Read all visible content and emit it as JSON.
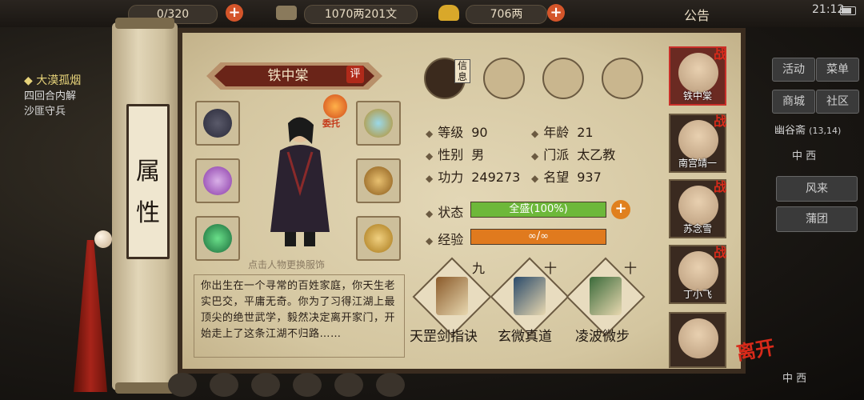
{
  "topbar": {
    "res1": "0/320",
    "coins": "1070两201文",
    "gold": "706两",
    "notice": "公告",
    "time": "21:12"
  },
  "quest": {
    "title": "大漠孤烟",
    "line1": "四回合内解",
    "line2": "沙匪守兵"
  },
  "right_menu": {
    "activity": "活动",
    "menu": "菜单",
    "shop": "商城",
    "community": "社区",
    "location": "幽谷斋",
    "coords": "(13,14)",
    "area": "中 西",
    "item1": "风来",
    "item2": "蒲团",
    "bottom": "中 西"
  },
  "scroll_tag": {
    "char1": "属",
    "char2": "性"
  },
  "character": {
    "name": "铁中棠",
    "rate_label": "评",
    "delegate_label": "委托",
    "hint": "点击人物更换服饰",
    "description": "你出生在一个寻常的百姓家庭，你天生老实巴交，平庸无奇。你为了习得江湖上最顶尖的绝世武学，毅然决定离开家门，开始走上了这条江湖不归路……"
  },
  "tabs": {
    "info_label": "信息"
  },
  "stats": {
    "level_label": "等级",
    "level": "90",
    "age_label": "年龄",
    "age": "21",
    "gender_label": "性别",
    "gender": "男",
    "sect_label": "门派",
    "sect": "太乙教",
    "power_label": "功力",
    "power": "249273",
    "fame_label": "名望",
    "fame": "937",
    "status_label": "状态",
    "status_text": "全盛(100%)",
    "status_fill": 1.0,
    "exp_label": "经验",
    "exp_text": "∞/∞",
    "exp_fill": 1.0
  },
  "skills": [
    {
      "level": "九",
      "name": "天罡剑指诀",
      "color": "#8a5a2a"
    },
    {
      "level": "十",
      "name": "玄微真道",
      "color": "#2a4a6a"
    },
    {
      "level": "十",
      "name": "凌波微步",
      "color": "#3a6a3a"
    }
  ],
  "roster": [
    {
      "name": "铁中棠",
      "tag": "战"
    },
    {
      "name": "南宫靖一",
      "tag": "战"
    },
    {
      "name": "苏念雪",
      "tag": "战"
    },
    {
      "name": "丁小飞",
      "tag": "战"
    }
  ],
  "leave_label": "离开",
  "colors": {
    "status_bar": "#6db83a",
    "exp_bar": "#e07a1e",
    "accent_red": "#b02a1a"
  }
}
